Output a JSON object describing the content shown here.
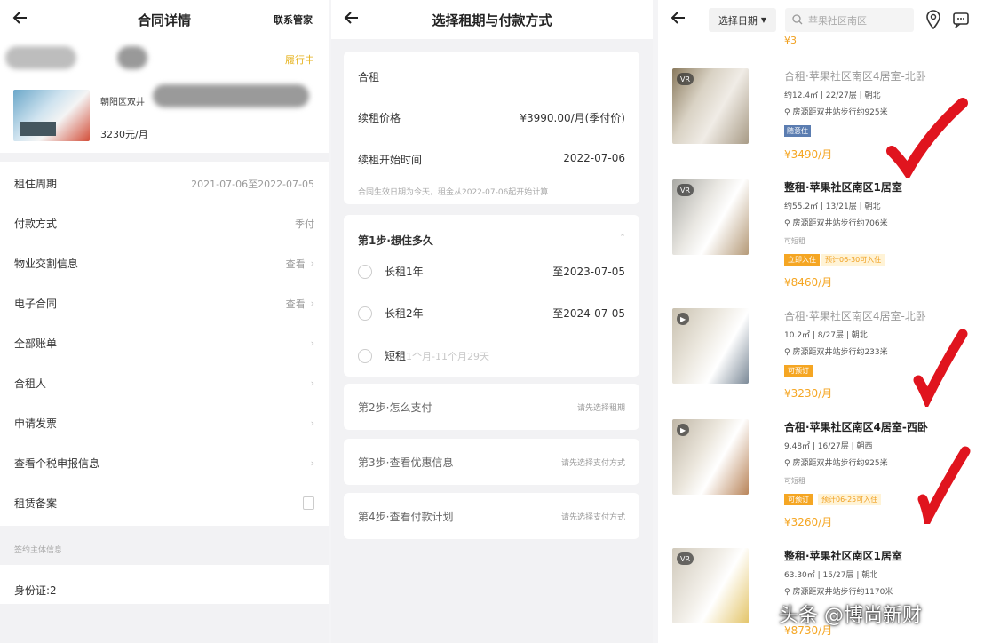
{
  "contract": {
    "title": "合同详情",
    "contact_label": "联系管家",
    "status": "履行中",
    "address": "朝阳区双井",
    "price": "3230元/月",
    "rows": [
      {
        "label": "租住周期",
        "value": "2021-07-06至2022-07-05"
      },
      {
        "label": "付款方式",
        "value": "季付"
      },
      {
        "label": "物业交割信息",
        "value": "查看"
      },
      {
        "label": "电子合同",
        "value": "查看"
      },
      {
        "label": "全部账单",
        "value": ""
      },
      {
        "label": "合租人",
        "value": ""
      },
      {
        "label": "申请发票",
        "value": ""
      },
      {
        "label": "查看个税申报信息",
        "value": ""
      },
      {
        "label": "租赁备案",
        "value": ""
      }
    ],
    "section_note": "签约主体信息",
    "id_label": "身份证:2"
  },
  "renew": {
    "title": "选择租期与付款方式",
    "type": "合租",
    "price_label": "续租价格",
    "price_value": "¥3990.00/月(季付价)",
    "start_label": "续租开始时间",
    "start_value": "2022-07-06",
    "start_note": "合同生效日期为今天，租金从2022-07-06起开始计算",
    "step1_title": "第1步·想住多久",
    "options": [
      {
        "label": "长租1年",
        "value": "至2023-07-05"
      },
      {
        "label": "长租2年",
        "value": "至2024-07-05"
      }
    ],
    "short_label": "短租",
    "short_hint": "1个月-11个月29天",
    "steps": [
      {
        "label": "第2步·怎么支付",
        "hint": "请先选择租期"
      },
      {
        "label": "第3步·查看优惠信息",
        "hint": "请先选择支付方式"
      },
      {
        "label": "第4步·查看付款计划",
        "hint": "请先选择支付方式"
      }
    ]
  },
  "search": {
    "date_label": "选择日期",
    "placeholder": "苹果社区南区",
    "top_price": "¥3"
  },
  "listings": [
    {
      "title": "合租·苹果社区南区4居室-北卧",
      "sub": "约12.4㎡ | 22/27层 | 朝北",
      "dist": "房源距双井站步行约925米",
      "tag1": "随意住",
      "tag2": "",
      "price": "¥3490/月",
      "vr": "VR"
    },
    {
      "title": "整租·苹果社区南区1居室",
      "sub": "约55.2㎡ | 13/21层 | 朝北",
      "dist": "房源距双井站步行约706米",
      "tag1": "可短租",
      "tag2": "立即入住",
      "tag3": "预计06-30可入住",
      "price": "¥8460/月",
      "vr": "VR"
    },
    {
      "title": "合租·苹果社区南区4居室-北卧",
      "sub": "10.2㎡ | 8/27层 | 朝北",
      "dist": "房源距双井站步行约233米",
      "tag1": "可预订",
      "tag2": "",
      "price": "¥3230/月",
      "vr": ""
    },
    {
      "title": "合租·苹果社区南区4居室-西卧",
      "sub": "9.48㎡ | 16/27层 | 朝西",
      "dist": "房源距双井站步行约925米",
      "tag1": "可短租",
      "tag2": "可预订",
      "tag3": "预计06-25可入住",
      "price": "¥3260/月",
      "vr": ""
    },
    {
      "title": "整租·苹果社区南区1居室",
      "sub": "63.30㎡ | 15/27层 | 朝北",
      "dist": "房源距双井站步行约1170米",
      "tag1": "",
      "tag2": "",
      "price": "¥8730/月",
      "vr": "VR"
    }
  ],
  "watermark": "头条 @博尚新财",
  "colors": {
    "accent": "#f5a623",
    "check": "#e0141e",
    "status": "#e6b21c"
  }
}
